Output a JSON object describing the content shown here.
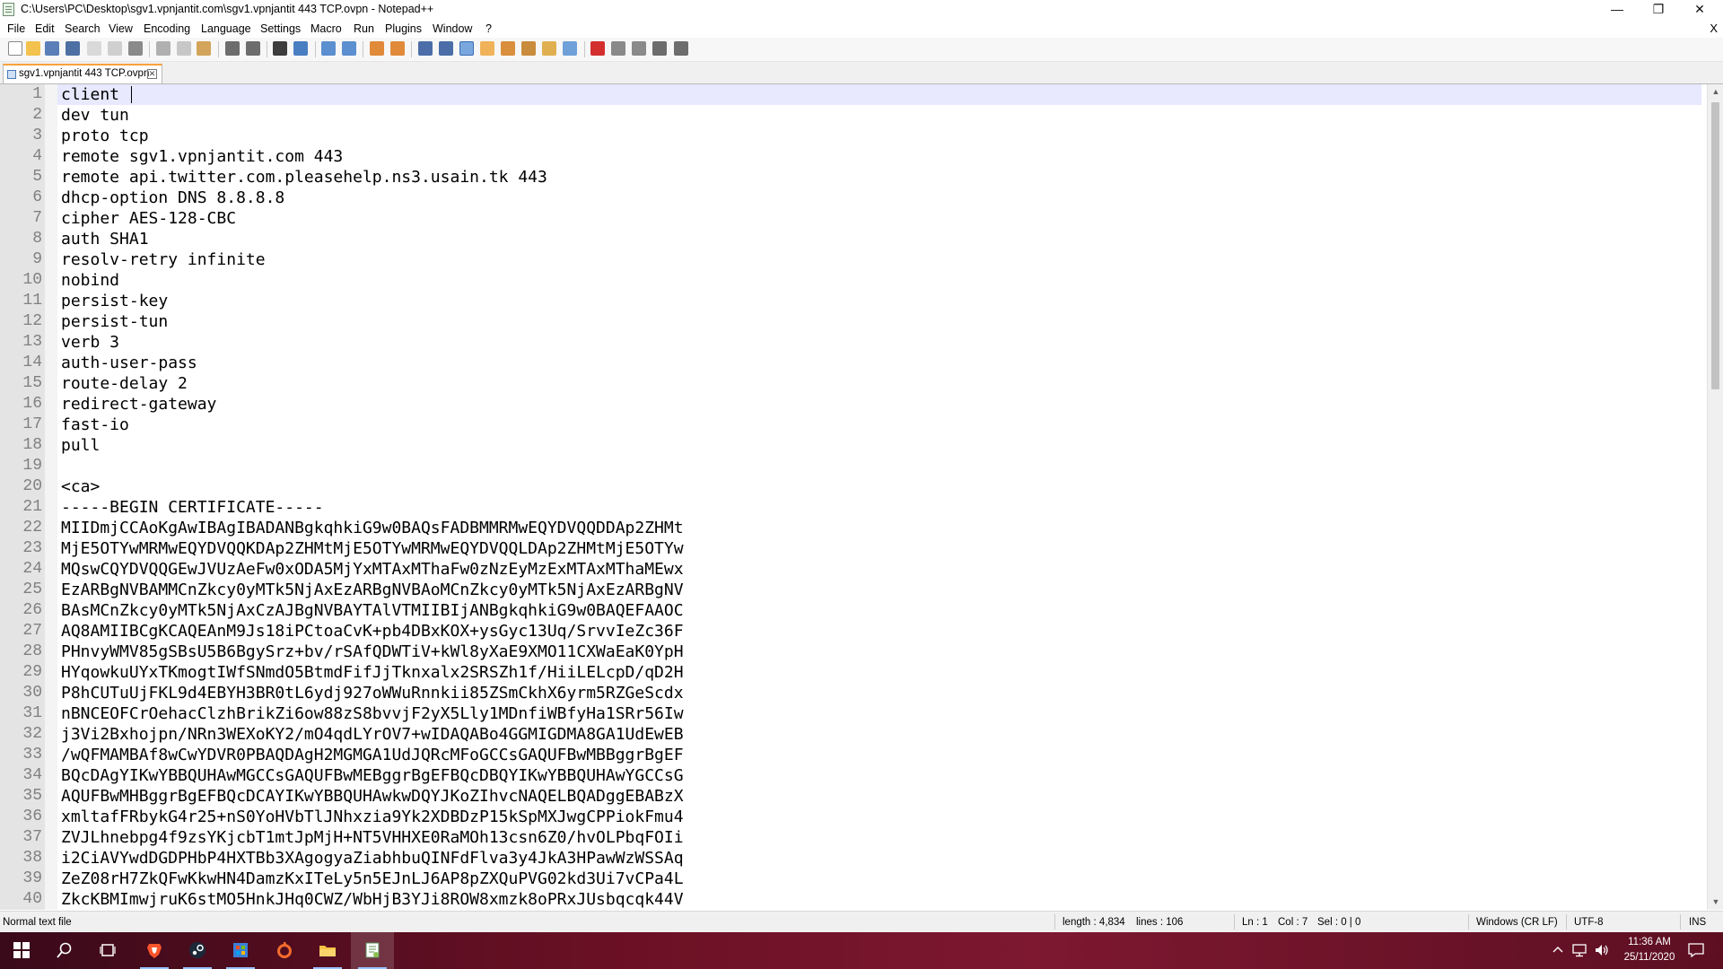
{
  "window": {
    "title": "C:\\Users\\PC\\Desktop\\sgv1.vpnjantit.com\\sgv1.vpnjantit 443 TCP.ovpn - Notepad++",
    "minimize_glyph": "—",
    "restore_glyph": "❐",
    "close_glyph": "✕"
  },
  "menu": {
    "items": [
      "File",
      "Edit",
      "Search",
      "View",
      "Encoding",
      "Language",
      "Settings",
      "Macro",
      "Run",
      "Plugins",
      "Window",
      "?"
    ],
    "close_glyph": "X"
  },
  "toolbar": {
    "icons": [
      "new-file-icon",
      "open-file-icon",
      "save-icon",
      "save-all-icon",
      "close-icon",
      "close-all-icon",
      "print-icon",
      "cut-icon",
      "copy-icon",
      "paste-icon",
      "undo-icon",
      "redo-icon",
      "find-icon",
      "replace-icon",
      "zoom-in-icon",
      "zoom-out-icon",
      "sync-vertical-icon",
      "sync-horizontal-icon",
      "word-wrap-icon",
      "show-all-chars-icon",
      "indent-guide-icon",
      "lang-udl-icon",
      "doc-map-icon",
      "function-list-icon",
      "folder-workspace-icon",
      "monitoring-icon",
      "record-macro-icon",
      "stop-macro-icon",
      "play-macro-icon",
      "run-macro-multiple-icon",
      "save-macro-icon"
    ]
  },
  "tab": {
    "label": "sgv1.vpnjantit 443 TCP.ovpn",
    "close_glyph": "✕"
  },
  "editor": {
    "lines": [
      "client",
      "dev tun",
      "proto tcp",
      "remote sgv1.vpnjantit.com 443",
      "remote api.twitter.com.pleasehelp.ns3.usain.tk 443",
      "dhcp-option DNS 8.8.8.8",
      "cipher AES-128-CBC",
      "auth SHA1",
      "resolv-retry infinite",
      "nobind",
      "persist-key",
      "persist-tun",
      "verb 3",
      "auth-user-pass",
      "route-delay 2",
      "redirect-gateway",
      "fast-io",
      "pull",
      "",
      "<ca>",
      "-----BEGIN CERTIFICATE-----",
      "MIIDmjCCAoKgAwIBAgIBADANBgkqhkiG9w0BAQsFADBMMRMwEQYDVQQDDAp2ZHMt",
      "MjE5OTYwMRMwEQYDVQQKDAp2ZHMtMjE5OTYwMRMwEQYDVQQLDAp2ZHMtMjE5OTYw",
      "MQswCQYDVQQGEwJVUzAeFw0xODA5MjYxMTAxMThaFw0zNzEyMzExMTAxMThaMEwx",
      "EzARBgNVBAMMCnZkcy0yMTk5NjAxEzARBgNVBAoMCnZkcy0yMTk5NjAxEzARBgNV",
      "BAsMCnZkcy0yMTk5NjAxCzAJBgNVBAYTAlVTMIIBIjANBgkqhkiG9w0BAQEFAAOC",
      "AQ8AMIIBCgKCAQEAnM9Js18iPCtoaCvK+pb4DBxKOX+ysGyc13Uq/SrvvIeZc36F",
      "PHnvyWMV85gSBsU5B6BgySrz+bv/rSAfQDWTiV+kWl8yXaE9XMO11CXWaEaK0YpH",
      "HYqowkuUYxTKmogtIWfSNmdO5BtmdFifJjTknxalx2SRSZh1f/HiiLELcpD/qD2H",
      "P8hCUTuUjFKL9d4EBYH3BR0tL6ydj927oWWuRnnkii85ZSmCkhX6yrm5RZGeScdx",
      "nBNCEOFCrOehacClzhBrikZi6ow88zS8bvvjF2yX5Lly1MDnfiWBfyHa1SRr56Iw",
      "j3Vi2Bxhojpn/NRn3WEXoKY2/mO4qdLYrOV7+wIDAQABo4GGMIGDMA8GA1UdEwEB",
      "/wQFMAMBAf8wCwYDVR0PBAQDAgH2MGMGA1UdJQRcMFoGCCsGAQUFBwMBBggrBgEF",
      "BQcDAgYIKwYBBQUHAwMGCCsGAQUFBwMEBggrBgEFBQcDBQYIKwYBBQUHAwYGCCsG",
      "AQUFBwMHBggrBgEFBQcDCAYIKwYBBQUHAwkwDQYJKoZIhvcNAQELBQADggEBABzX",
      "xmltafFRbykG4r25+nS0YoHVbTlJNhxzia9Yk2XDBDzP15kSpMXJwgCPPiokFmu4",
      "ZVJLhnebpg4f9zsYKjcbT1mtJpMjH+NT5VHHXE0RaMOh13csn6Z0/hvOLPbqFOIi",
      "i2CiAVYwdDGDPHbP4HXTBb3XAgogyaZiabhbuQINFdFlva3y4JkA3HPawWzWSSAq",
      "ZeZ08rH7ZkQFwKkwHN4DamzKxITeLy5n5EJnLJ6AP8pZXQuPVG02kd3Ui7vCPa4L",
      "ZkcKBMImwjruK6stMO5HnkJHq0CWZ/WbHjB3YJi8ROW8xmzk8oPRxJUsbqcqk44V"
    ]
  },
  "statusbar": {
    "file_type": "Normal text file",
    "length": "length : 4,834",
    "lines": "lines : 106",
    "ln": "Ln : 1",
    "col": "Col : 7",
    "sel": "Sel : 0 | 0",
    "eol": "Windows (CR LF)",
    "encoding": "UTF-8",
    "mode": "INS"
  },
  "taskbar": {
    "icons": [
      "windows-start-icon",
      "search-icon",
      "task-view-icon",
      "brave-browser-icon",
      "steam-icon",
      "store-app-icon",
      "origin-icon",
      "file-explorer-icon",
      "notepad-plus-plus-icon"
    ],
    "tray": {
      "time": "11:36 AM",
      "date": "25/11/2020"
    }
  },
  "colors": {
    "current_line": "#e8e8ff",
    "gutter": "#e4e4e4",
    "tab_accent": "#f7a23b",
    "taskbar": "#6a1024"
  }
}
